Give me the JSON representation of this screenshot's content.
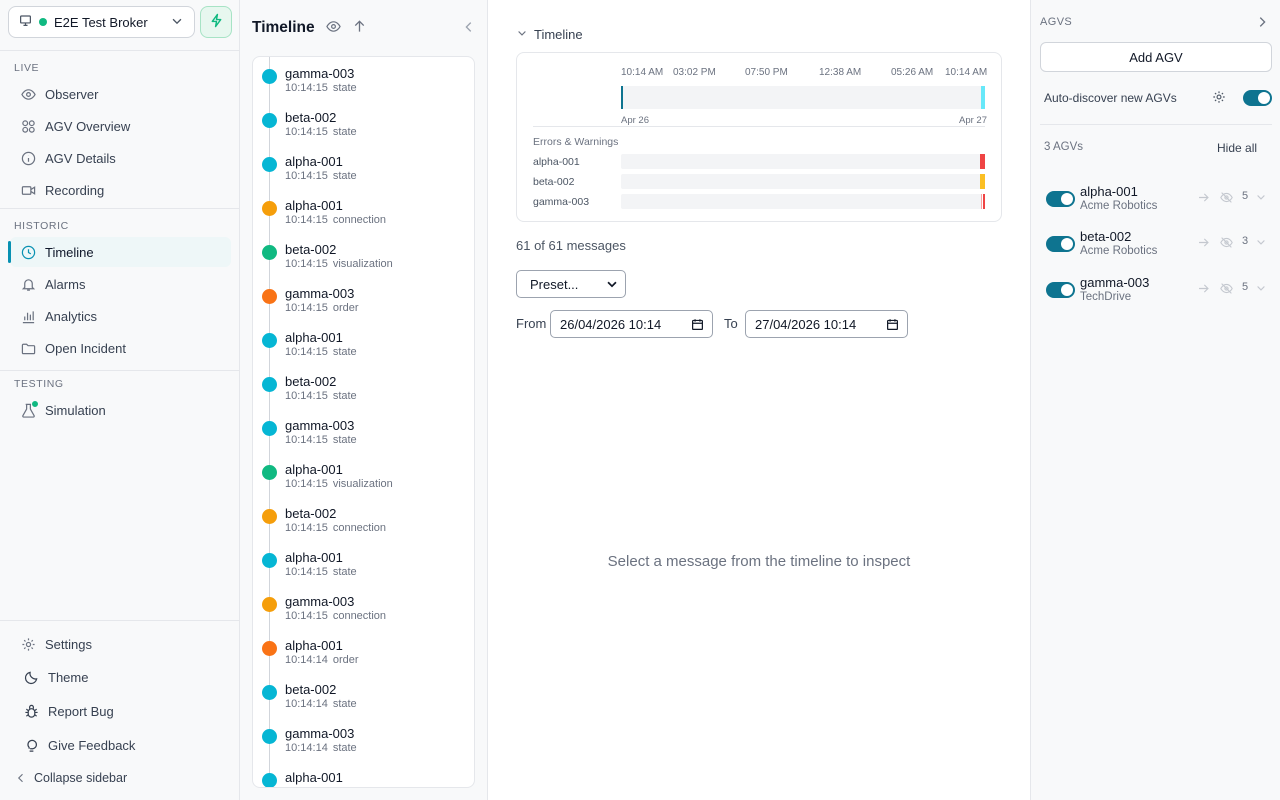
{
  "broker": {
    "name": "E2E Test Broker",
    "status_color": "#10b981"
  },
  "sidebar": {
    "sections": {
      "live": "LIVE",
      "historic": "HISTORIC",
      "testing": "TESTING"
    },
    "live_items": [
      {
        "label": "Observer",
        "icon": "eye-icon"
      },
      {
        "label": "AGV Overview",
        "icon": "grid-icon"
      },
      {
        "label": "AGV Details",
        "icon": "info-icon"
      },
      {
        "label": "Recording",
        "icon": "video-icon"
      }
    ],
    "historic_items": [
      {
        "label": "Timeline",
        "icon": "clock-icon",
        "active": true
      },
      {
        "label": "Alarms",
        "icon": "bell-icon"
      },
      {
        "label": "Analytics",
        "icon": "bar-chart-icon"
      },
      {
        "label": "Open Incident",
        "icon": "folder-icon"
      }
    ],
    "testing_items": [
      {
        "label": "Simulation",
        "icon": "flask-icon"
      }
    ],
    "footer": {
      "settings": "Settings",
      "theme": "Theme",
      "report_bug": "Report Bug",
      "feedback": "Give Feedback",
      "collapse": "Collapse sidebar"
    }
  },
  "timeline_panel": {
    "title": "Timeline",
    "items": [
      {
        "agv": "gamma-003",
        "time": "10:14:15",
        "type": "state"
      },
      {
        "agv": "beta-002",
        "time": "10:14:15",
        "type": "state"
      },
      {
        "agv": "alpha-001",
        "time": "10:14:15",
        "type": "state"
      },
      {
        "agv": "alpha-001",
        "time": "10:14:15",
        "type": "connection"
      },
      {
        "agv": "beta-002",
        "time": "10:14:15",
        "type": "visualization"
      },
      {
        "agv": "gamma-003",
        "time": "10:14:15",
        "type": "order"
      },
      {
        "agv": "alpha-001",
        "time": "10:14:15",
        "type": "state"
      },
      {
        "agv": "beta-002",
        "time": "10:14:15",
        "type": "state"
      },
      {
        "agv": "gamma-003",
        "time": "10:14:15",
        "type": "state"
      },
      {
        "agv": "alpha-001",
        "time": "10:14:15",
        "type": "visualization"
      },
      {
        "agv": "beta-002",
        "time": "10:14:15",
        "type": "connection"
      },
      {
        "agv": "alpha-001",
        "time": "10:14:15",
        "type": "state"
      },
      {
        "agv": "gamma-003",
        "time": "10:14:15",
        "type": "connection"
      },
      {
        "agv": "alpha-001",
        "time": "10:14:14",
        "type": "order"
      },
      {
        "agv": "beta-002",
        "time": "10:14:14",
        "type": "state"
      },
      {
        "agv": "gamma-003",
        "time": "10:14:14",
        "type": "state"
      },
      {
        "agv": "alpha-001",
        "time": "",
        "type": ""
      }
    ],
    "type_colors": {
      "state": "#06b6d4",
      "connection": "#f59e0b",
      "visualization": "#10b981",
      "order": "#f97316"
    }
  },
  "main": {
    "timeline_toggle": "Timeline",
    "ticks": [
      "10:14 AM",
      "03:02 PM",
      "07:50 PM",
      "12:38 AM",
      "05:26 AM",
      "10:14 AM"
    ],
    "date_start": "Apr 26",
    "date_end": "Apr 27",
    "errors_label": "Errors & Warnings",
    "error_rows": [
      {
        "agv": "alpha-001",
        "color": "#ef4444"
      },
      {
        "agv": "beta-002",
        "color": "#fbbf24"
      },
      {
        "agv": "gamma-003",
        "color": "#ef4444"
      }
    ],
    "message_count": "61 of 61 messages",
    "preset": "Preset...",
    "from_label": "From",
    "from_value": "26/04/2026 10:14",
    "to_label": "To",
    "to_value": "27/04/2026 10:14",
    "empty_state": "Select a message from the timeline to inspect"
  },
  "right_panel": {
    "title": "AGVS",
    "add_button": "Add AGV",
    "auto_discover": "Auto-discover new AGVs",
    "count": "3 AGVs",
    "hide_all": "Hide all",
    "agvs": [
      {
        "name": "alpha-001",
        "vendor": "Acme Robotics",
        "count": "5"
      },
      {
        "name": "beta-002",
        "vendor": "Acme Robotics",
        "count": "3"
      },
      {
        "name": "gamma-003",
        "vendor": "TechDrive",
        "count": "5"
      }
    ]
  },
  "colors": {
    "accent": "#0891b2",
    "toggle": "#0e7490"
  }
}
